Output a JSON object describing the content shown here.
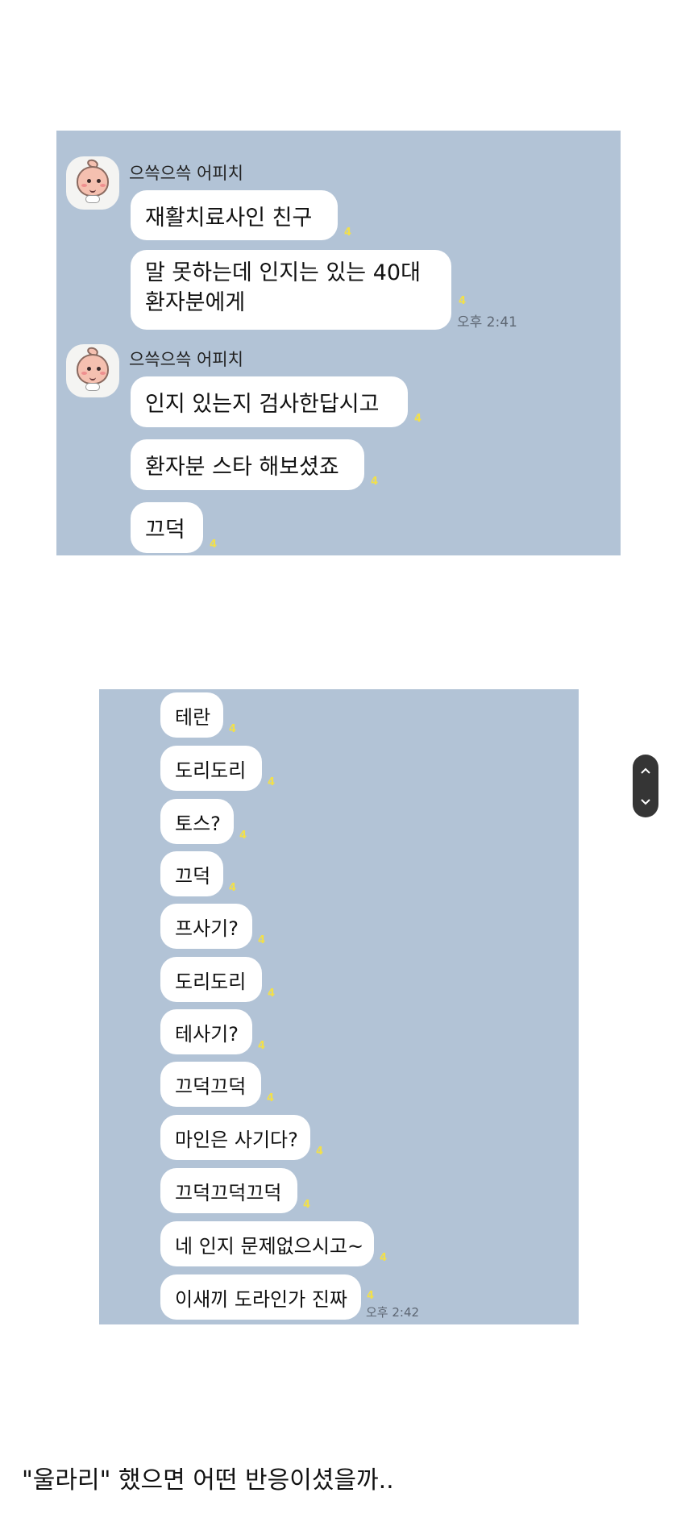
{
  "chat1": {
    "sender1": "으쓱으쓱 어피치",
    "sender2": "으쓱으쓱 어피치",
    "messages": [
      {
        "text": "재활치료사인 친구",
        "unread": "4"
      },
      {
        "text": "말 못하는데 인지는 있는 40대\n환자분에게",
        "unread": "4",
        "time": "오후 2:41"
      },
      {
        "text": "인지 있는지 검사한답시고",
        "unread": "4"
      },
      {
        "text": "환자분 스타 해보셨죠",
        "unread": "4"
      },
      {
        "text": "끄덕",
        "unread": "4"
      }
    ]
  },
  "chat2": {
    "messages": [
      {
        "text": "테란",
        "unread": "4"
      },
      {
        "text": "도리도리",
        "unread": "4"
      },
      {
        "text": "토스?",
        "unread": "4"
      },
      {
        "text": "끄덕",
        "unread": "4"
      },
      {
        "text": "프사기?",
        "unread": "4"
      },
      {
        "text": "도리도리",
        "unread": "4"
      },
      {
        "text": "테사기?",
        "unread": "4"
      },
      {
        "text": "끄덕끄덕",
        "unread": "4"
      },
      {
        "text": "마인은 사기다?",
        "unread": "4"
      },
      {
        "text": "끄덕끄덕끄덕",
        "unread": "4"
      },
      {
        "text": "네 인지 문제없으시고~",
        "unread": "4"
      },
      {
        "text": "이새끼 도라인가 진짜",
        "unread": "4",
        "time": "오후 2:42"
      }
    ]
  },
  "scroll": {
    "up_icon": "chevron-up-icon",
    "down_icon": "chevron-down-icon"
  },
  "caption": "\"울라리\" 했으면 어떤 반응이셨을까.."
}
